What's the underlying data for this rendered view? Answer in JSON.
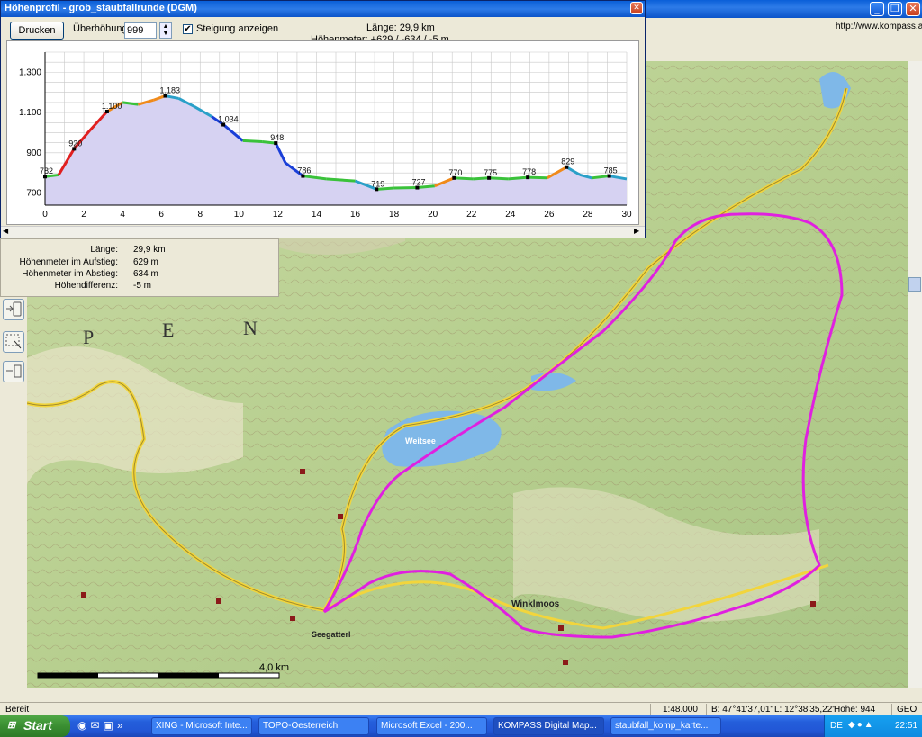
{
  "main_window": {
    "url_label": "http://www.kompass.at",
    "controls": {
      "minimize": "_",
      "maximize": "❐",
      "close": "✕"
    }
  },
  "profile_window": {
    "title": "Höhenprofil - grob_staubfallrunde (DGM)",
    "close": "✕",
    "print_button": "Drucken",
    "exaggeration_label": "Überhöhung",
    "exaggeration_value": "999",
    "slope_checkbox_label": "Steigung anzeigen",
    "slope_checked": true,
    "length_text": "Länge: 29,9 km",
    "elevation_text": "Höhenmeter: +629 / -634 / -5 m"
  },
  "stats": {
    "rows": [
      {
        "label": "Länge:",
        "value": "29,9 km"
      },
      {
        "label": "Höhenmeter im Aufstieg:",
        "value": "629  m"
      },
      {
        "label": "Höhenmeter im Abstieg:",
        "value": "634  m"
      },
      {
        "label": "Höhendifferenz:",
        "value": "-5  m"
      }
    ]
  },
  "map": {
    "labels": [
      "P",
      "E",
      "N",
      "Weitsee",
      "Winklmoos",
      "Seegatterl"
    ],
    "scale_label": "4,0 km",
    "route_color": "#e020e0",
    "water_color": "#7fb8e8"
  },
  "status_bar": {
    "ready": "Bereit",
    "scale": "1:48.000",
    "lat": "B: 47°41'37,01\"",
    "lon": "L: 12°38'35,22\"",
    "height": "Höhe: 944",
    "mode": "GEO"
  },
  "taskbar": {
    "start": "Start",
    "tasks": [
      {
        "label": "XING - Microsoft Inte...",
        "active": false
      },
      {
        "label": "TOPO-Oesterreich",
        "active": false
      },
      {
        "label": "Microsoft Excel - 200...",
        "active": false
      },
      {
        "label": "KOMPASS Digital Map...",
        "active": true
      },
      {
        "label": "staubfall_komp_karte...",
        "active": false
      }
    ],
    "lang": "DE",
    "clock": "22:51"
  },
  "chart_data": {
    "type": "area",
    "xlabel": "",
    "ylabel": "",
    "xlim": [
      0,
      30
    ],
    "ylim": [
      640,
      1400
    ],
    "x_ticks": [
      0,
      2,
      4,
      6,
      8,
      10,
      12,
      14,
      16,
      18,
      20,
      22,
      24,
      26,
      28,
      30
    ],
    "y_ticks": [
      700,
      900,
      1100,
      1300
    ],
    "y_tick_labels": [
      "700",
      "900",
      "1.100",
      "1.300"
    ],
    "series": [
      {
        "x": [
          0,
          0.7,
          1.5,
          2.3,
          3.2,
          4,
          4.8,
          5.6,
          6.2,
          6.9,
          7.7,
          8.6,
          9.2,
          10.2,
          11.2,
          11.9,
          12.4,
          13.3,
          14.5,
          16,
          17.1,
          18,
          19.2,
          20.1,
          21.1,
          22.1,
          22.9,
          23.9,
          24.9,
          25.9,
          26.9,
          27.6,
          28.2,
          29.1,
          30
        ],
        "y": [
          782,
          790,
          920,
          1010,
          1105,
          1150,
          1140,
          1162,
          1183,
          1170,
          1130,
          1080,
          1040,
          960,
          955,
          948,
          850,
          785,
          770,
          760,
          719,
          725,
          727,
          735,
          775,
          770,
          775,
          770,
          778,
          775,
          829,
          790,
          775,
          785,
          770
        ]
      }
    ],
    "annotations": [
      {
        "x": 0,
        "y": 782,
        "label": "782"
      },
      {
        "x": 1.5,
        "y": 920,
        "label": "920"
      },
      {
        "x": 3.2,
        "y": 1105,
        "label": "1.100"
      },
      {
        "x": 6.2,
        "y": 1183,
        "label": "1.183"
      },
      {
        "x": 9.2,
        "y": 1040,
        "label": "1.034"
      },
      {
        "x": 11.9,
        "y": 948,
        "label": "948"
      },
      {
        "x": 13.3,
        "y": 785,
        "label": "786"
      },
      {
        "x": 17.1,
        "y": 719,
        "label": "719"
      },
      {
        "x": 19.2,
        "y": 727,
        "label": "727"
      },
      {
        "x": 21.1,
        "y": 775,
        "label": "770"
      },
      {
        "x": 22.9,
        "y": 775,
        "label": "775"
      },
      {
        "x": 24.9,
        "y": 778,
        "label": "778"
      },
      {
        "x": 26.9,
        "y": 829,
        "label": "829"
      },
      {
        "x": 29.1,
        "y": 785,
        "label": "785"
      }
    ],
    "grid": true
  }
}
